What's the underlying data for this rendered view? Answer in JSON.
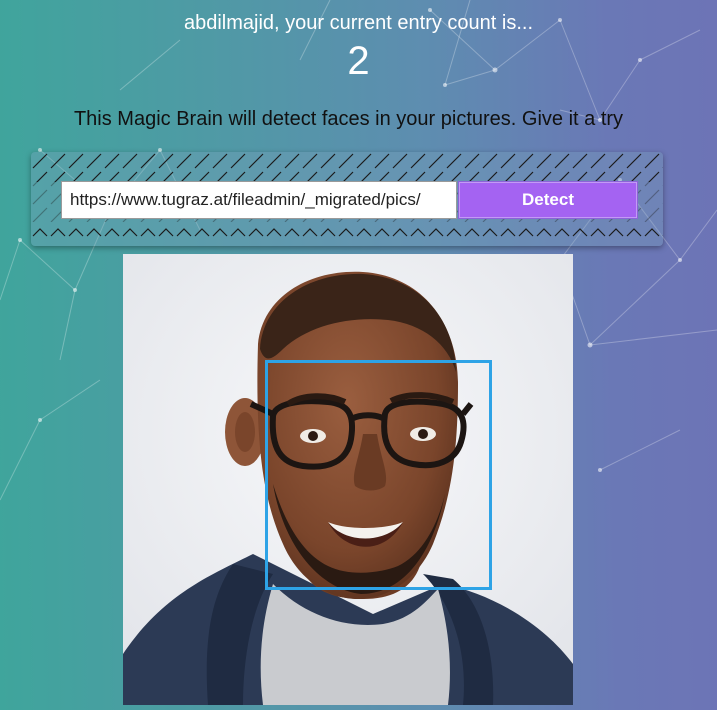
{
  "header": {
    "entry_text": "abdilmajid, your current entry count is...",
    "entry_count": "2"
  },
  "intro": {
    "text": "This Magic Brain will detect faces in your pictures. Give it a try"
  },
  "image_form": {
    "url_value": "https://www.tugraz.at/fileadmin/_migrated/pics/",
    "detect_label": "Detect"
  },
  "result": {
    "face_count": 1
  },
  "colors": {
    "gradient_start": "#3fa59c",
    "gradient_end": "#6d74b6",
    "detect_button": "#a463f2",
    "face_box": "#2ea3e6"
  }
}
